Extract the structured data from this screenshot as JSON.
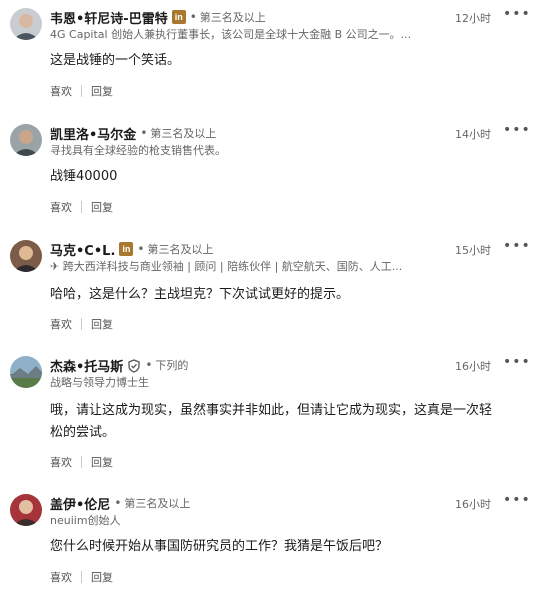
{
  "comments": [
    {
      "name": "韦恩•轩尼诗-巴雷特",
      "has_li_badge": true,
      "degree": "第三名及以上",
      "headline": "4G Capital 创始人兼执行董事长，该公司是全球十大金融 B 公司之一。...",
      "time": "12小时",
      "text": "这是战锤的一个笑话。",
      "like": "喜欢",
      "reply": "回复"
    },
    {
      "name": "凯里洛•马尔金",
      "has_li_badge": false,
      "degree": "第三名及以上",
      "headline": "寻找具有全球经验的枪支销售代表。",
      "time": "14小时",
      "text": "战锤40000",
      "like": "喜欢",
      "reply": "回复"
    },
    {
      "name": "马克•C•L.",
      "has_li_badge": true,
      "degree": "第三名及以上",
      "headline": "✈ 跨大西洋科技与商业领袖 | 顾问 | 陪练伙伴 | 航空航天、国防、人工...",
      "time": "15小时",
      "text": "哈哈，这是什么？主战坦克？下次试试更好的提示。",
      "like": "喜欢",
      "reply": "回复"
    },
    {
      "name": "杰森•托马斯",
      "has_verified": true,
      "degree": "下列的",
      "headline": "战略与领导力博士生",
      "time": "16小时",
      "text": "哦，请让这成为现实，虽然事实并非如此，但请让它成为现实，这真是一次轻松的尝试。",
      "like": "喜欢",
      "reply": "回复"
    },
    {
      "name": "盖伊•伦尼",
      "has_li_badge": false,
      "degree": "第三名及以上",
      "headline": "neuiim创始人",
      "time": "16小时",
      "text": "您什么时候开始从事国防研究员的工作？我猜是午饭后吧？",
      "like": "喜欢",
      "reply": "回复"
    }
  ],
  "li_badge_text": "in",
  "more_glyph": "•••",
  "colors": {
    "badge": "#a8782e",
    "muted": "#666666",
    "text": "#1a1a1a"
  }
}
